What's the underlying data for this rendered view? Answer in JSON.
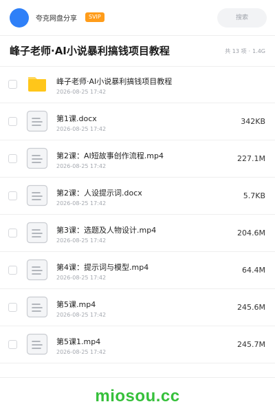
{
  "header": {
    "app_name": "夸克网盘分享",
    "badge": "SVIP",
    "search_placeholder": "搜索"
  },
  "folder": {
    "title": "峰子老师·AI小说暴利搞钱项目教程",
    "count": "共 13 项",
    "separator": "·",
    "total_size": "1.4G"
  },
  "files": [
    {
      "type": "folder",
      "icon": "folder-icon",
      "name": "峰子老师·AI小说暴利搞钱项目教程",
      "date": "2026-08-25 17:42",
      "size": ""
    },
    {
      "type": "file",
      "icon": "document-icon",
      "name": "第1课.docx",
      "date": "2026-08-25 17:42",
      "size": "342KB"
    },
    {
      "type": "file",
      "icon": "document-icon",
      "name": "第2课：AI短故事创作流程.mp4",
      "date": "2026-08-25 17:42",
      "size": "227.1M"
    },
    {
      "type": "file",
      "icon": "document-icon",
      "name": "第2课：人设提示词.docx",
      "date": "2026-08-25 17:42",
      "size": "5.7KB"
    },
    {
      "type": "file",
      "icon": "document-icon",
      "name": "第3课：选题及人物设计.mp4",
      "date": "2026-08-25 17:42",
      "size": "204.6M"
    },
    {
      "type": "file",
      "icon": "document-icon",
      "name": "第4课：提示词与模型.mp4",
      "date": "2026-08-25 17:42",
      "size": "64.4M"
    },
    {
      "type": "file",
      "icon": "document-icon",
      "name": "第5课.mp4",
      "date": "2026-08-25 17:42",
      "size": "245.6M"
    },
    {
      "type": "file",
      "icon": "document-icon",
      "name": "第5课1.mp4",
      "date": "2026-08-25 17:42",
      "size": "245.7M"
    }
  ],
  "watermark": "miosou.cc",
  "colors": {
    "accent": "#2f80f8",
    "badge": "#ff9c1a",
    "folder": "#ffc61a",
    "watermark": "#36c03b"
  }
}
